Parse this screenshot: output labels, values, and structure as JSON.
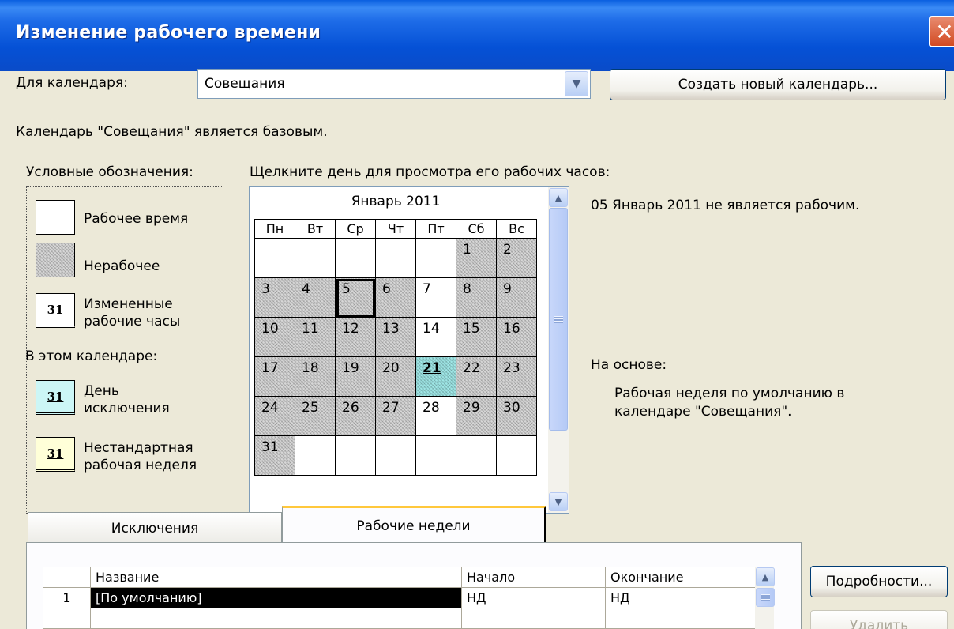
{
  "window": {
    "title": "Изменение рабочего времени",
    "close_label": "✕"
  },
  "header": {
    "for_calendar_label": "Для календаря:",
    "calendar_select_value": "Совещания",
    "create_button": "Создать новый календарь...",
    "base_info": "Календарь \"Совещания\" является базовым."
  },
  "legend": {
    "title": "Условные обозначения:",
    "working": "Рабочее время",
    "nonworking": "Нерабочее",
    "changed_line1": "Измененные",
    "changed_line2": "рабочие часы",
    "in_calendar": "В этом календаре:",
    "exception_line1": "День",
    "exception_line2": "исключения",
    "nonstandard_line1": "Нестандартная",
    "nonstandard_line2": "рабочая неделя",
    "box_number": "31"
  },
  "calendar": {
    "hint": "Щелкните день для просмотра его рабочих часов:",
    "month": "Январь 2011",
    "weekdays": [
      "Пн",
      "Вт",
      "Ср",
      "Чт",
      "Пт",
      "Сб",
      "Вс"
    ],
    "weeks": [
      [
        {
          "d": "",
          "t": "w"
        },
        {
          "d": "",
          "t": "w"
        },
        {
          "d": "",
          "t": "w"
        },
        {
          "d": "",
          "t": "w"
        },
        {
          "d": "",
          "t": "w"
        },
        {
          "d": "1",
          "t": "n"
        },
        {
          "d": "2",
          "t": "n"
        }
      ],
      [
        {
          "d": "3",
          "t": "n"
        },
        {
          "d": "4",
          "t": "n"
        },
        {
          "d": "5",
          "t": "n",
          "sel": true
        },
        {
          "d": "6",
          "t": "n"
        },
        {
          "d": "7",
          "t": "w"
        },
        {
          "d": "8",
          "t": "n"
        },
        {
          "d": "9",
          "t": "n"
        }
      ],
      [
        {
          "d": "10",
          "t": "n"
        },
        {
          "d": "11",
          "t": "n"
        },
        {
          "d": "12",
          "t": "n"
        },
        {
          "d": "13",
          "t": "n"
        },
        {
          "d": "14",
          "t": "w"
        },
        {
          "d": "15",
          "t": "n"
        },
        {
          "d": "16",
          "t": "n"
        }
      ],
      [
        {
          "d": "17",
          "t": "n"
        },
        {
          "d": "18",
          "t": "n"
        },
        {
          "d": "19",
          "t": "n"
        },
        {
          "d": "20",
          "t": "n"
        },
        {
          "d": "21",
          "t": "e"
        },
        {
          "d": "22",
          "t": "n"
        },
        {
          "d": "23",
          "t": "n"
        }
      ],
      [
        {
          "d": "24",
          "t": "n"
        },
        {
          "d": "25",
          "t": "n"
        },
        {
          "d": "26",
          "t": "n"
        },
        {
          "d": "27",
          "t": "n"
        },
        {
          "d": "28",
          "t": "w"
        },
        {
          "d": "29",
          "t": "n"
        },
        {
          "d": "30",
          "t": "n"
        }
      ],
      [
        {
          "d": "31",
          "t": "n"
        },
        {
          "d": "",
          "t": "w"
        },
        {
          "d": "",
          "t": "w"
        },
        {
          "d": "",
          "t": "w"
        },
        {
          "d": "",
          "t": "w"
        },
        {
          "d": "",
          "t": "w"
        },
        {
          "d": "",
          "t": "w"
        }
      ]
    ],
    "status": "05 Январь 2011 не является рабочим.",
    "based_on_label": "На основе:",
    "based_on_line1": "Рабочая неделя по умолчанию в",
    "based_on_line2": "календаре \"Совещания\"."
  },
  "tabs": [
    {
      "label": "Исключения",
      "active": false
    },
    {
      "label": "Рабочие недели",
      "active": true
    }
  ],
  "weeks_table": {
    "headers": [
      "",
      "Название",
      "Начало",
      "Окончание"
    ],
    "rows": [
      [
        "1",
        "[По умолчанию]",
        "НД",
        "НД"
      ],
      [
        "",
        "",
        "",
        ""
      ]
    ]
  },
  "side_buttons": {
    "details": "Подробности...",
    "delete": "Удалить"
  },
  "colors": {
    "exception": "#9FE7E6",
    "title_bar": "#0A5FE0",
    "close": "#D24A22"
  }
}
